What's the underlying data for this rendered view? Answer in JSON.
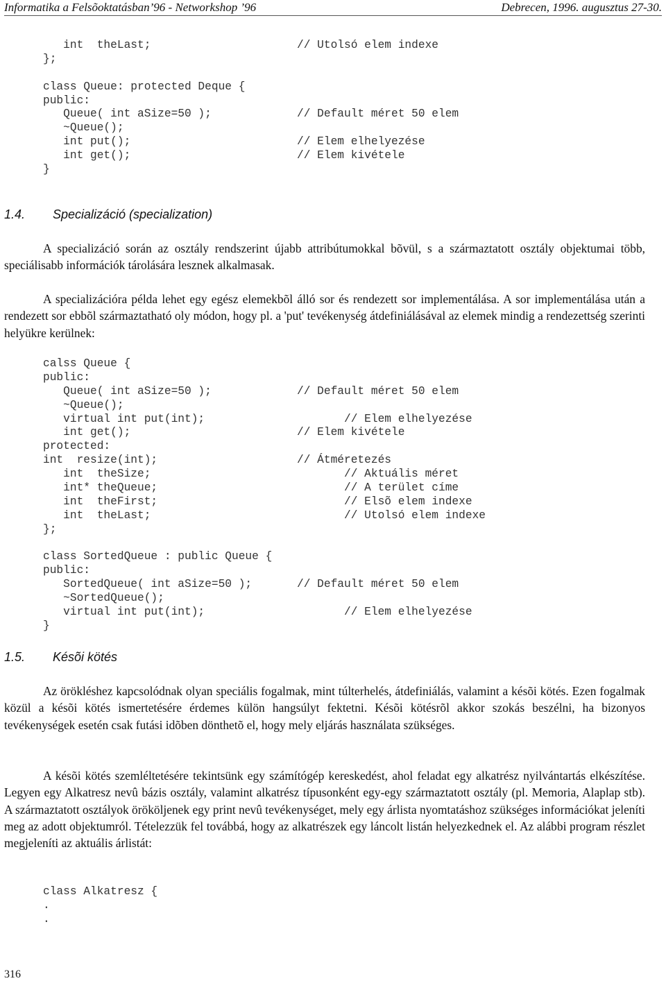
{
  "header": {
    "left": "Informatika a Felsõoktatásban’96 - Networkshop ’96",
    "right": "Debrecen, 1996. augusztus 27-30."
  },
  "code_block_1": {
    "lines": [
      {
        "code": "   int  theLast;",
        "comment": "// Utolsó elem indexe"
      },
      {
        "code": "};",
        "comment": ""
      },
      {
        "code": "",
        "comment": ""
      },
      {
        "code": "class Queue: protected Deque {",
        "comment": ""
      },
      {
        "code": "public:",
        "comment": ""
      },
      {
        "code": "   Queue( int aSize=50 );",
        "comment": "// Default méret 50 elem"
      },
      {
        "code": "   ~Queue();",
        "comment": ""
      },
      {
        "code": "   int put();",
        "comment": "// Elem elhelyezése"
      },
      {
        "code": "   int get();",
        "comment": "// Elem kivétele"
      },
      {
        "code": "}",
        "comment": ""
      }
    ]
  },
  "section_1_4": {
    "number": "1.4.",
    "title": "Specializáció (specialization)",
    "paragraphs": [
      "A specializáció során az osztály rendszerint újabb attribútumokkal bõvül, s a származtatott osztály objektumai több, speciálisabb információk tárolására lesznek alkalmasak.",
      "A specializációra példa lehet egy egész elemekbõl álló sor és rendezett sor implementálása. A sor implementálása után a rendezett sor ebbõl származtatható oly módon, hogy pl. a 'put' tevékenység átdefiniálásával az elemek mindig a rendezettség szerinti helyükre kerülnek:"
    ]
  },
  "code_block_2": {
    "lines": [
      {
        "code": "calss Queue {",
        "comment": ""
      },
      {
        "code": "public:",
        "comment": ""
      },
      {
        "code": "   Queue( int aSize=50 );",
        "comment": "// Default méret 50 elem"
      },
      {
        "code": "   ~Queue();",
        "comment": ""
      },
      {
        "code": "   virtual int put(int);",
        "comment": "       // Elem elhelyezése"
      },
      {
        "code": "   int get();",
        "comment": "// Elem kivétele"
      },
      {
        "code": "protected:",
        "comment": ""
      },
      {
        "code": "int  resize(int);",
        "comment": "// Átméretezés"
      },
      {
        "code": "   int  theSize;",
        "comment": "       // Aktuális méret"
      },
      {
        "code": "   int* theQueue;",
        "comment": "       // A terület címe"
      },
      {
        "code": "   int  theFirst;",
        "comment": "       // Elsõ elem indexe"
      },
      {
        "code": "   int  theLast;",
        "comment": "       // Utolsó elem indexe"
      },
      {
        "code": "};",
        "comment": ""
      },
      {
        "code": "",
        "comment": ""
      },
      {
        "code": "class SortedQueue : public Queue {",
        "comment": ""
      },
      {
        "code": "public:",
        "comment": ""
      },
      {
        "code": "   SortedQueue( int aSize=50 );",
        "comment": "// Default méret 50 elem"
      },
      {
        "code": "   ~SortedQueue();",
        "comment": ""
      },
      {
        "code": "   virtual int put(int);",
        "comment": "       // Elem elhelyezése"
      },
      {
        "code": "}",
        "comment": ""
      }
    ]
  },
  "section_1_5": {
    "number": "1.5.",
    "title": "Késõi kötés",
    "paragraphs": [
      "Az örökléshez kapcsolódnak olyan speciális fogalmak, mint túlterhelés, átdefiniálás, valamint a késõi kötés. Ezen fogalmak közül a késõi kötés ismertetésére érdemes külön hangsúlyt fektetni. Késõi kötésrõl akkor szokás beszélni, ha bizonyos tevékenységek esetén csak futási idõben dönthetõ el, hogy mely eljárás használata szükséges.",
      "A késõi kötés szemléltetésére tekintsünk egy számítógép kereskedést, ahol feladat egy alkatrész nyilvántartás elkészítése. Legyen egy Alkatresz nevû bázis osztály, valamint alkatrész típusonként egy-egy származtatott osztály (pl. Memoria, Alaplap stb). A származtatott osztályok örököljenek egy print nevû tevékenységet, mely egy árlista nyomtatáshoz szükséges információkat jeleníti meg az adott objektumról. Tételezzük fel továbbá, hogy az alkatrészek egy láncolt listán helyezkednek el. Az alábbi program részlet megjeleníti az aktuális árlistát:"
    ]
  },
  "code_block_3": {
    "lines": [
      {
        "code": "class Alkatresz {",
        "comment": ""
      },
      {
        "code": ".",
        "comment": ""
      },
      {
        "code": ".",
        "comment": ""
      }
    ]
  },
  "footer": {
    "page_number": "316"
  }
}
